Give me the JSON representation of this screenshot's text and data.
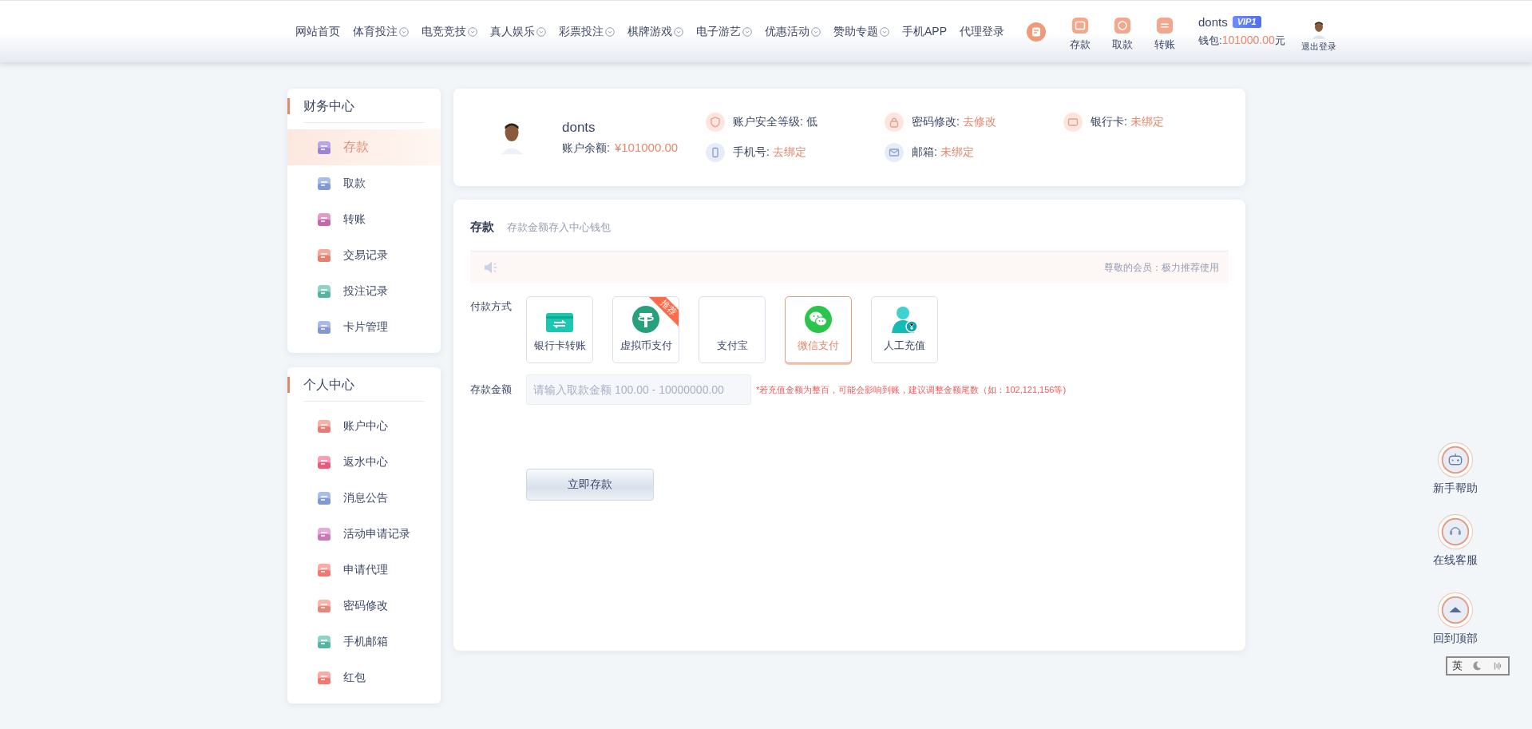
{
  "nav": {
    "items": [
      {
        "label": "网站首页",
        "has_menu": false
      },
      {
        "label": "体育投注",
        "has_menu": true
      },
      {
        "label": "电竞竞技",
        "has_menu": true
      },
      {
        "label": "真人娱乐",
        "has_menu": true
      },
      {
        "label": "彩票投注",
        "has_menu": true
      },
      {
        "label": "棋牌游戏",
        "has_menu": true
      },
      {
        "label": "电子游艺",
        "has_menu": true
      },
      {
        "label": "优惠活动",
        "has_menu": true
      },
      {
        "label": "赞助专题",
        "has_menu": true
      },
      {
        "label": "手机APP",
        "has_menu": false
      },
      {
        "label": "代理登录",
        "has_menu": false
      }
    ],
    "actions": [
      {
        "label": "存款",
        "kind": "deposit"
      },
      {
        "label": "取款",
        "kind": "withdraw"
      },
      {
        "label": "转账",
        "kind": "transfer"
      }
    ],
    "username": "donts",
    "vip": "VIP1",
    "wallet_label": "钱包:",
    "wallet_amount": "101000.00",
    "wallet_unit": "元",
    "logout": "退出登录"
  },
  "sidebar": [
    {
      "title": "财务中心",
      "items": [
        {
          "label": "存款",
          "selected": true
        },
        {
          "label": "取款",
          "selected": false
        },
        {
          "label": "转账",
          "selected": false
        },
        {
          "label": "交易记录",
          "selected": false
        },
        {
          "label": "投注记录",
          "selected": false
        },
        {
          "label": "卡片管理",
          "selected": false
        }
      ]
    },
    {
      "title": "个人中心",
      "items": [
        {
          "label": "账户中心",
          "selected": false
        },
        {
          "label": "返水中心",
          "selected": false
        },
        {
          "label": "消息公告",
          "selected": false
        },
        {
          "label": "活动申请记录",
          "selected": false
        },
        {
          "label": "申请代理",
          "selected": false
        },
        {
          "label": "密码修改",
          "selected": false
        },
        {
          "label": "手机邮箱",
          "selected": false
        },
        {
          "label": "红包",
          "selected": false
        }
      ]
    }
  ],
  "profile": {
    "name": "donts",
    "balance_label": "账户余额:",
    "balance": "¥101000.00",
    "security": [
      {
        "label": "账户安全等级:",
        "value": "低",
        "kind": "shield",
        "highlight": false
      },
      {
        "label": "密码修改:",
        "value": "去修改",
        "kind": "lock",
        "highlight": true
      },
      {
        "label": "银行卡:",
        "value": "未绑定",
        "kind": "card",
        "highlight": true
      },
      {
        "label": "手机号:",
        "value": "去绑定",
        "kind": "phone",
        "highlight": true
      },
      {
        "label": "邮箱:",
        "value": "未绑定",
        "kind": "mail",
        "highlight": true
      }
    ]
  },
  "deposit": {
    "title": "存款",
    "subtitle": "存款金额存入中心钱包",
    "notice": "尊敬的会员：极力推荐使用",
    "method_label": "付款方式",
    "methods": [
      {
        "label": "银行卡转账",
        "kind": "bank",
        "selected": false
      },
      {
        "label": "虚拟币支付",
        "kind": "crypto",
        "selected": false,
        "badge": "推荐"
      },
      {
        "label": "支付宝",
        "kind": "alipay",
        "selected": false
      },
      {
        "label": "微信支付",
        "kind": "wechat",
        "selected": true
      },
      {
        "label": "人工充值",
        "kind": "manual",
        "selected": false
      }
    ],
    "amount_label": "存款金额",
    "amount_placeholder": "请输入取款金额 100.00 - 10000000.00",
    "hint": "*若充值金额为整百，可能会影响到账，建议调整金额尾数（如：102,121,156等)",
    "submit": "立即存款"
  },
  "float_buttons": [
    {
      "label": "新手帮助",
      "kind": "robot"
    },
    {
      "label": "在线客服",
      "kind": "headset"
    },
    {
      "label": "回到顶部",
      "kind": "top"
    }
  ],
  "ime": {
    "label": "英"
  }
}
